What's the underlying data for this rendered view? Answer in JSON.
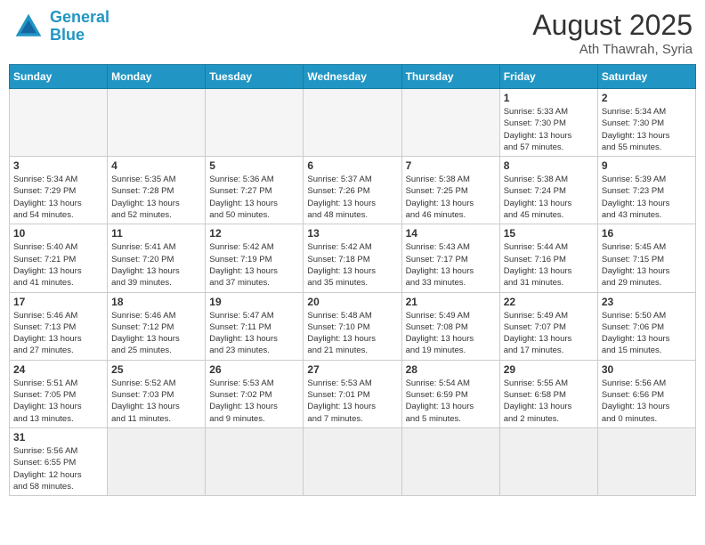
{
  "header": {
    "logo_general": "General",
    "logo_blue": "Blue",
    "month_year": "August 2025",
    "location": "Ath Thawrah, Syria"
  },
  "days_of_week": [
    "Sunday",
    "Monday",
    "Tuesday",
    "Wednesday",
    "Thursday",
    "Friday",
    "Saturday"
  ],
  "weeks": [
    [
      {
        "day": "",
        "info": ""
      },
      {
        "day": "",
        "info": ""
      },
      {
        "day": "",
        "info": ""
      },
      {
        "day": "",
        "info": ""
      },
      {
        "day": "",
        "info": ""
      },
      {
        "day": "1",
        "info": "Sunrise: 5:33 AM\nSunset: 7:30 PM\nDaylight: 13 hours\nand 57 minutes."
      },
      {
        "day": "2",
        "info": "Sunrise: 5:34 AM\nSunset: 7:30 PM\nDaylight: 13 hours\nand 55 minutes."
      }
    ],
    [
      {
        "day": "3",
        "info": "Sunrise: 5:34 AM\nSunset: 7:29 PM\nDaylight: 13 hours\nand 54 minutes."
      },
      {
        "day": "4",
        "info": "Sunrise: 5:35 AM\nSunset: 7:28 PM\nDaylight: 13 hours\nand 52 minutes."
      },
      {
        "day": "5",
        "info": "Sunrise: 5:36 AM\nSunset: 7:27 PM\nDaylight: 13 hours\nand 50 minutes."
      },
      {
        "day": "6",
        "info": "Sunrise: 5:37 AM\nSunset: 7:26 PM\nDaylight: 13 hours\nand 48 minutes."
      },
      {
        "day": "7",
        "info": "Sunrise: 5:38 AM\nSunset: 7:25 PM\nDaylight: 13 hours\nand 46 minutes."
      },
      {
        "day": "8",
        "info": "Sunrise: 5:38 AM\nSunset: 7:24 PM\nDaylight: 13 hours\nand 45 minutes."
      },
      {
        "day": "9",
        "info": "Sunrise: 5:39 AM\nSunset: 7:23 PM\nDaylight: 13 hours\nand 43 minutes."
      }
    ],
    [
      {
        "day": "10",
        "info": "Sunrise: 5:40 AM\nSunset: 7:21 PM\nDaylight: 13 hours\nand 41 minutes."
      },
      {
        "day": "11",
        "info": "Sunrise: 5:41 AM\nSunset: 7:20 PM\nDaylight: 13 hours\nand 39 minutes."
      },
      {
        "day": "12",
        "info": "Sunrise: 5:42 AM\nSunset: 7:19 PM\nDaylight: 13 hours\nand 37 minutes."
      },
      {
        "day": "13",
        "info": "Sunrise: 5:42 AM\nSunset: 7:18 PM\nDaylight: 13 hours\nand 35 minutes."
      },
      {
        "day": "14",
        "info": "Sunrise: 5:43 AM\nSunset: 7:17 PM\nDaylight: 13 hours\nand 33 minutes."
      },
      {
        "day": "15",
        "info": "Sunrise: 5:44 AM\nSunset: 7:16 PM\nDaylight: 13 hours\nand 31 minutes."
      },
      {
        "day": "16",
        "info": "Sunrise: 5:45 AM\nSunset: 7:15 PM\nDaylight: 13 hours\nand 29 minutes."
      }
    ],
    [
      {
        "day": "17",
        "info": "Sunrise: 5:46 AM\nSunset: 7:13 PM\nDaylight: 13 hours\nand 27 minutes."
      },
      {
        "day": "18",
        "info": "Sunrise: 5:46 AM\nSunset: 7:12 PM\nDaylight: 13 hours\nand 25 minutes."
      },
      {
        "day": "19",
        "info": "Sunrise: 5:47 AM\nSunset: 7:11 PM\nDaylight: 13 hours\nand 23 minutes."
      },
      {
        "day": "20",
        "info": "Sunrise: 5:48 AM\nSunset: 7:10 PM\nDaylight: 13 hours\nand 21 minutes."
      },
      {
        "day": "21",
        "info": "Sunrise: 5:49 AM\nSunset: 7:08 PM\nDaylight: 13 hours\nand 19 minutes."
      },
      {
        "day": "22",
        "info": "Sunrise: 5:49 AM\nSunset: 7:07 PM\nDaylight: 13 hours\nand 17 minutes."
      },
      {
        "day": "23",
        "info": "Sunrise: 5:50 AM\nSunset: 7:06 PM\nDaylight: 13 hours\nand 15 minutes."
      }
    ],
    [
      {
        "day": "24",
        "info": "Sunrise: 5:51 AM\nSunset: 7:05 PM\nDaylight: 13 hours\nand 13 minutes."
      },
      {
        "day": "25",
        "info": "Sunrise: 5:52 AM\nSunset: 7:03 PM\nDaylight: 13 hours\nand 11 minutes."
      },
      {
        "day": "26",
        "info": "Sunrise: 5:53 AM\nSunset: 7:02 PM\nDaylight: 13 hours\nand 9 minutes."
      },
      {
        "day": "27",
        "info": "Sunrise: 5:53 AM\nSunset: 7:01 PM\nDaylight: 13 hours\nand 7 minutes."
      },
      {
        "day": "28",
        "info": "Sunrise: 5:54 AM\nSunset: 6:59 PM\nDaylight: 13 hours\nand 5 minutes."
      },
      {
        "day": "29",
        "info": "Sunrise: 5:55 AM\nSunset: 6:58 PM\nDaylight: 13 hours\nand 2 minutes."
      },
      {
        "day": "30",
        "info": "Sunrise: 5:56 AM\nSunset: 6:56 PM\nDaylight: 13 hours\nand 0 minutes."
      }
    ],
    [
      {
        "day": "31",
        "info": "Sunrise: 5:56 AM\nSunset: 6:55 PM\nDaylight: 12 hours\nand 58 minutes."
      },
      {
        "day": "",
        "info": ""
      },
      {
        "day": "",
        "info": ""
      },
      {
        "day": "",
        "info": ""
      },
      {
        "day": "",
        "info": ""
      },
      {
        "day": "",
        "info": ""
      },
      {
        "day": "",
        "info": ""
      }
    ]
  ]
}
